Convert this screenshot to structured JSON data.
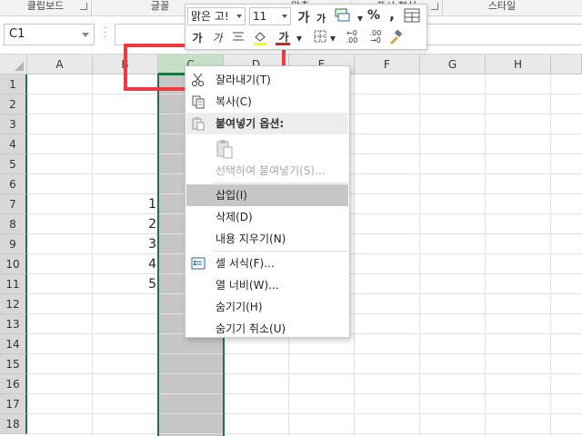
{
  "ribbon": {
    "groups": [
      "클립보드",
      "글꼴",
      "맞춤",
      "표시 형식",
      "스타일"
    ]
  },
  "formula_bar": {
    "name_box": "C1",
    "formula": ""
  },
  "grid": {
    "columns": [
      "A",
      "B",
      "C",
      "D",
      "E",
      "F",
      "G",
      "H"
    ],
    "selected_column": "C",
    "rows": [
      "1",
      "2",
      "3",
      "4",
      "5",
      "6",
      "7",
      "8",
      "9",
      "10",
      "11",
      "12",
      "13",
      "14",
      "15",
      "16",
      "17",
      "18"
    ],
    "cells": [
      {
        "ref": "B7",
        "value": "1"
      },
      {
        "ref": "B8",
        "value": "2"
      },
      {
        "ref": "B9",
        "value": "3"
      },
      {
        "ref": "B10",
        "value": "4"
      },
      {
        "ref": "B11",
        "value": "5"
      }
    ]
  },
  "mini_toolbar": {
    "font_name": "맑은 고!",
    "font_size": "11",
    "grow_font": "가",
    "shrink_font": "가",
    "percent": "%",
    "comma": ",",
    "bold": "가",
    "italic": "가",
    "font_color_label": "가",
    "increase_decimal": "←0 .00",
    "decrease_decimal": ".00 →0",
    "colors": {
      "font_color": "#e02020",
      "fill_color": "#ffff00"
    }
  },
  "context_menu": {
    "items": [
      {
        "label": "잘라내기(T)",
        "icon": "scissors-icon",
        "state": "normal"
      },
      {
        "label": "복사(C)",
        "icon": "copy-icon",
        "state": "normal"
      },
      {
        "label": "붙여넣기 옵션:",
        "icon": "paste-icon",
        "state": "header"
      },
      {
        "label": "",
        "icon": "paste-option-icon",
        "state": "disabled"
      },
      {
        "label": "선택하여 붙여넣기(S)...",
        "icon": "",
        "state": "disabled"
      },
      {
        "label": "삽입(I)",
        "icon": "",
        "state": "hover"
      },
      {
        "label": "삭제(D)",
        "icon": "",
        "state": "normal"
      },
      {
        "label": "내용 지우기(N)",
        "icon": "",
        "state": "normal"
      },
      {
        "label": "셀 서식(F)...",
        "icon": "format-cells-icon",
        "state": "normal"
      },
      {
        "label": "열 너비(W)...",
        "icon": "",
        "state": "normal"
      },
      {
        "label": "숨기기(H)",
        "icon": "",
        "state": "normal"
      },
      {
        "label": "숨기기 취소(U)",
        "icon": "",
        "state": "normal"
      }
    ]
  },
  "colors": {
    "accent": "#217346",
    "highlight_box": "#ee3b40",
    "selection_fill": "#c6c6c6"
  }
}
